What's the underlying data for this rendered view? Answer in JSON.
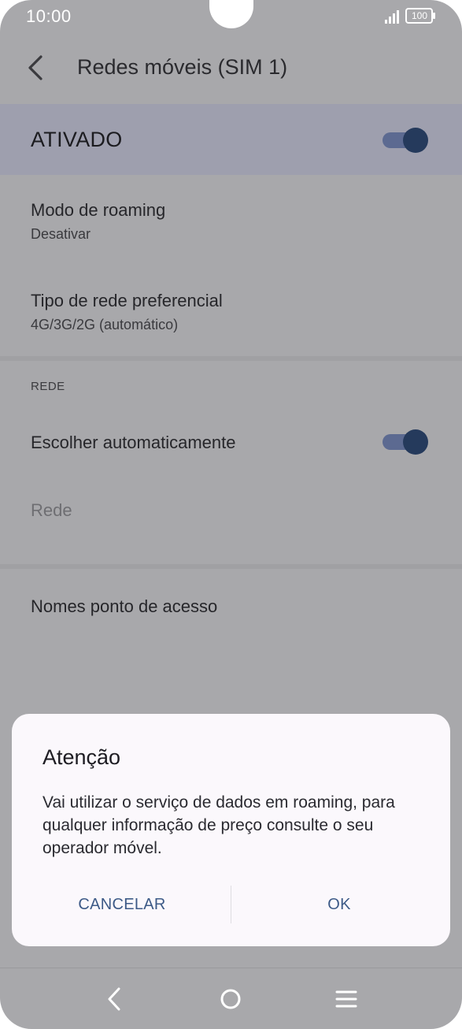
{
  "status_bar": {
    "time": "10:00",
    "battery": "100",
    "icons": [
      "signal-icon",
      "battery-icon"
    ]
  },
  "app_bar": {
    "title": "Redes móveis (SIM 1)",
    "back_icon": "back-arrow-icon"
  },
  "master_switch": {
    "label": "ATIVADO",
    "on": true
  },
  "settings": {
    "roaming_mode": {
      "title": "Modo de roaming",
      "value": "Desativar"
    },
    "preferred_network": {
      "title": "Tipo de rede preferencial",
      "value": "4G/3G/2G (automático)"
    },
    "network_section": {
      "header": "REDE",
      "auto_select": {
        "title": "Escolher automaticamente",
        "on": true
      },
      "network": {
        "title": "Rede"
      }
    },
    "apn": {
      "title": "Nomes ponto de acesso"
    }
  },
  "dialog": {
    "title": "Atenção",
    "message": "Vai utilizar o serviço de dados em roaming, para qualquer informação de preço consulte o seu operador móvel.",
    "cancel_label": "CANCELAR",
    "ok_label": "OK"
  },
  "nav_bar": {
    "icons": [
      "nav-back-icon",
      "nav-home-icon",
      "nav-menu-icon"
    ]
  },
  "colors": {
    "scrim_background": "#a8a8ab",
    "master_band": "#9e9fae",
    "toggle_track": "#5c6a91",
    "toggle_thumb": "#253a5c",
    "dialog_background": "#fbf8fc",
    "dialog_button_text": "#3d5a87"
  }
}
